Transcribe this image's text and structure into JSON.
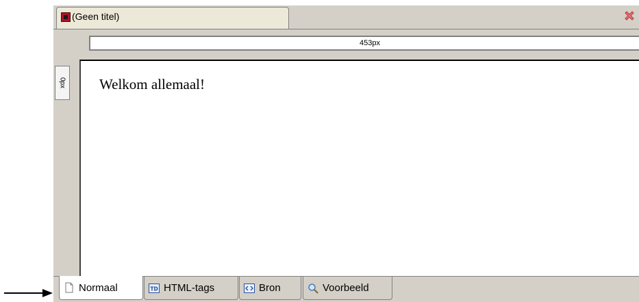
{
  "document_tab": {
    "title": "(Geen titel)",
    "icon": "document-icon"
  },
  "close_button": {
    "icon": "close-icon"
  },
  "rulers": {
    "horizontal_label": "453px",
    "vertical_label": "0px"
  },
  "content": {
    "text": "Welkom allemaal!"
  },
  "view_tabs": [
    {
      "label": "Normaal",
      "icon": "page-icon",
      "active": true
    },
    {
      "label": "HTML-tags",
      "icon": "td-tag-icon",
      "active": false
    },
    {
      "label": "Bron",
      "icon": "source-code-icon",
      "active": false
    },
    {
      "label": "Voorbeeld",
      "icon": "magnifier-icon",
      "active": false
    }
  ],
  "annotation": {
    "icon": "arrow-right-icon"
  }
}
